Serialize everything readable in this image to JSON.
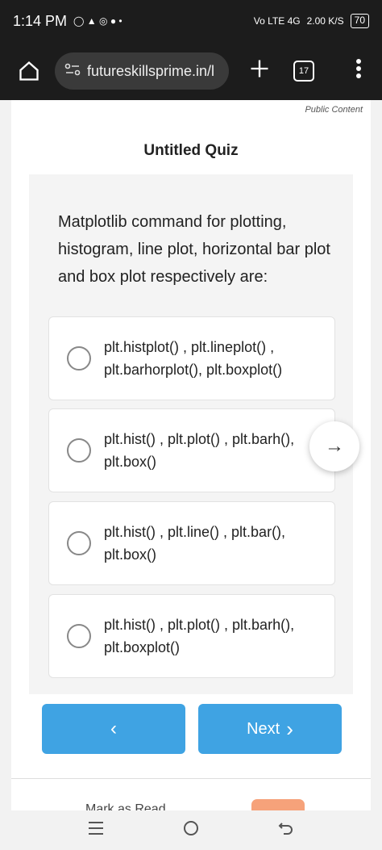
{
  "status_bar": {
    "time": "1:14 PM",
    "left_icons": "◯ ▲ ◎ ● •",
    "signal": "Vo LTE 4G",
    "net_speed": "2.00 K/S",
    "battery": "70"
  },
  "browser": {
    "url": "futureskillsprime.in/l",
    "tab_count": "17"
  },
  "page": {
    "public_label": "Public Content",
    "quiz_title": "Untitled Quiz",
    "question": "Matplotlib command for plotting, histogram, line plot, horizontal bar plot and box plot respectively are:",
    "options": [
      {
        "label": "plt.histplot() , plt.lineplot() , plt.barhorplot(), plt.boxplot()"
      },
      {
        "label": "plt.hist() , plt.plot() , plt.barh(), plt.box()"
      },
      {
        "label": "plt.hist() , plt.line() , plt.bar(), plt.box()"
      },
      {
        "label": "plt.hist() , plt.plot() , plt.barh(), plt.boxplot()"
      }
    ],
    "prev_label": "‹",
    "next_label": "Next",
    "next_chevron": "›",
    "fab_arrow": "→",
    "mark_read": "Mark as Read"
  },
  "colors": {
    "accent": "#3fa3e3",
    "status_bg": "#1c1c1c"
  }
}
